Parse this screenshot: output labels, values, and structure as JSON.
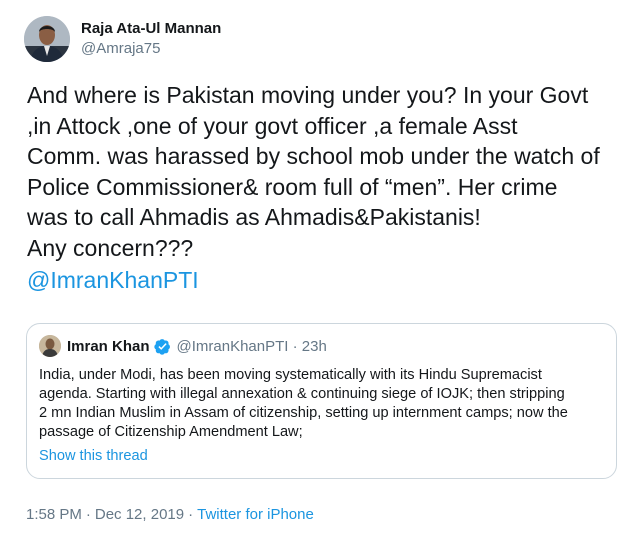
{
  "author": {
    "name": "Raja Ata-Ul Mannan",
    "handle": "@Amraja75"
  },
  "tweet": {
    "text": "And where is Pakistan moving under you? In your Govt\n,in Attock ,one of your govt officer ,a female Asst\nComm. was harassed by school mob under the watch of\nPolice Commissioner& room full of “men”. Her crime\nwas to call Ahmadis as Ahmadis&Pakistanis!\nAny concern???",
    "mention": "@ImranKhanPTI"
  },
  "quoted": {
    "name": "Imran Khan",
    "handle_time": "@ImranKhanPTI · 23h",
    "text": "India, under Modi, has been moving systematically with its Hindu Supremacist\nagenda. Starting with illegal annexation & continuing siege of IOJK; then stripping\n2 mn Indian Muslim in Assam of citizenship, setting up internment camps; now the\npassage of  Citizenship Amendment Law;",
    "show_thread": "Show this thread"
  },
  "footer": {
    "time": "1:58 PM",
    "date": "Dec 12, 2019",
    "separator": "·",
    "source": "Twitter for iPhone"
  },
  "colors": {
    "link": "#1b95e0",
    "muted": "#657786",
    "border": "#ccd6dd"
  },
  "icons": {
    "verified": "verified-badge-icon"
  }
}
